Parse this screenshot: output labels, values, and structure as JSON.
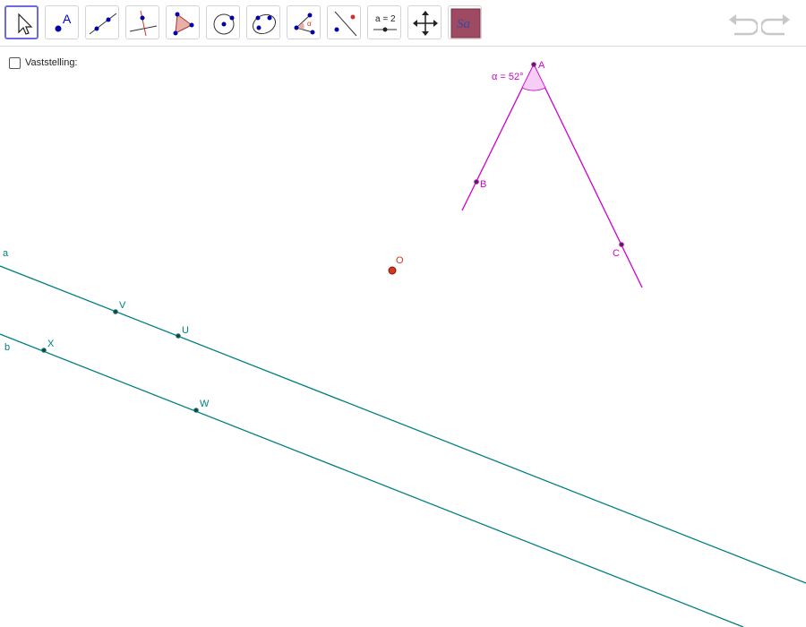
{
  "toolbar": {
    "tools": [
      {
        "name": "Move"
      },
      {
        "name": "Point",
        "glyph": "A"
      },
      {
        "name": "Line"
      },
      {
        "name": "Perpendicular Line"
      },
      {
        "name": "Polygon"
      },
      {
        "name": "Circle with Center"
      },
      {
        "name": "Ellipse"
      },
      {
        "name": "Angle",
        "glyph": "α"
      },
      {
        "name": "Reflect about Line"
      },
      {
        "name": "Slider",
        "glyph": "a = 2"
      },
      {
        "name": "Move Graphics View"
      },
      {
        "name": "Style Bar",
        "glyph": "Sa"
      }
    ],
    "undo_icon": "undo-arrow-icon",
    "redo_icon": "redo-arrow-icon"
  },
  "checkbox": {
    "label": "Vaststelling:",
    "checked": false
  },
  "geometry": {
    "angle_label": "α = 52°",
    "points": {
      "A": "A",
      "B": "B",
      "C": "C",
      "O": "O",
      "V": "V",
      "U": "U",
      "X": "X",
      "W": "W"
    },
    "lines": {
      "a": "a",
      "b": "b"
    }
  },
  "colors": {
    "teal": "#008080",
    "magenta": "#cc00cc",
    "point_red": "#d23a1e",
    "active_tool_border": "#6b6bdb"
  }
}
